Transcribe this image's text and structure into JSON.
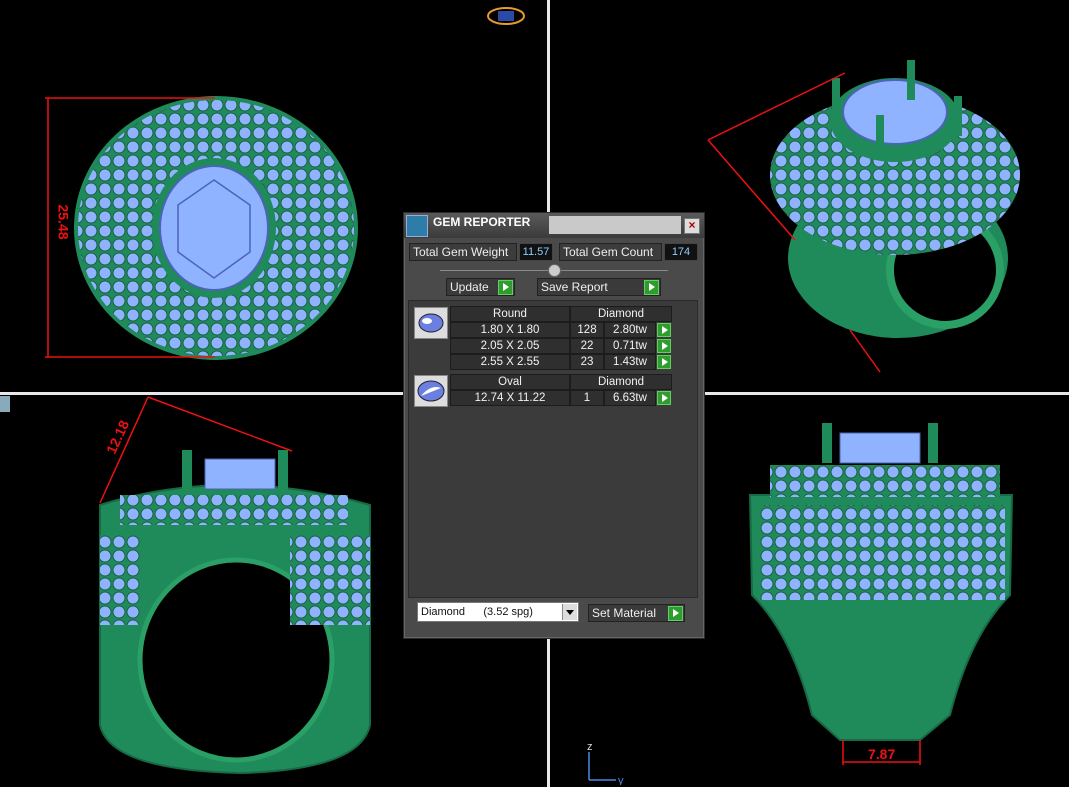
{
  "colors": {
    "metal": "#1f8a5a",
    "gem": "#8fb3ff",
    "dimension": "#e11111",
    "background": "#000000"
  },
  "dimensions": {
    "top_left": "25.48",
    "bottom_left": "12.18",
    "bottom_right": "7.87"
  },
  "gem_reporter": {
    "title": "GEM REPORTER",
    "total_weight_label": "Total Gem Weight",
    "total_weight_value": "11.57",
    "total_count_label": "Total Gem Count",
    "total_count_value": "174",
    "update_label": "Update",
    "save_label": "Save Report",
    "groups": [
      {
        "shape": "Round",
        "material": "Diamond",
        "rows": [
          {
            "size": "1.80 X 1.80",
            "count": "128",
            "weight": "2.80tw"
          },
          {
            "size": "2.05 X 2.05",
            "count": "22",
            "weight": "0.71tw"
          },
          {
            "size": "2.55 X 2.55",
            "count": "23",
            "weight": "1.43tw"
          }
        ]
      },
      {
        "shape": "Oval",
        "material": "Diamond",
        "rows": [
          {
            "size": "12.74 X 11.22",
            "count": "1",
            "weight": "6.63tw"
          }
        ]
      }
    ],
    "material_select": "Diamond      (3.52 spg)",
    "set_material_label": "Set Material"
  },
  "axis": {
    "z": "z",
    "y": "y"
  }
}
